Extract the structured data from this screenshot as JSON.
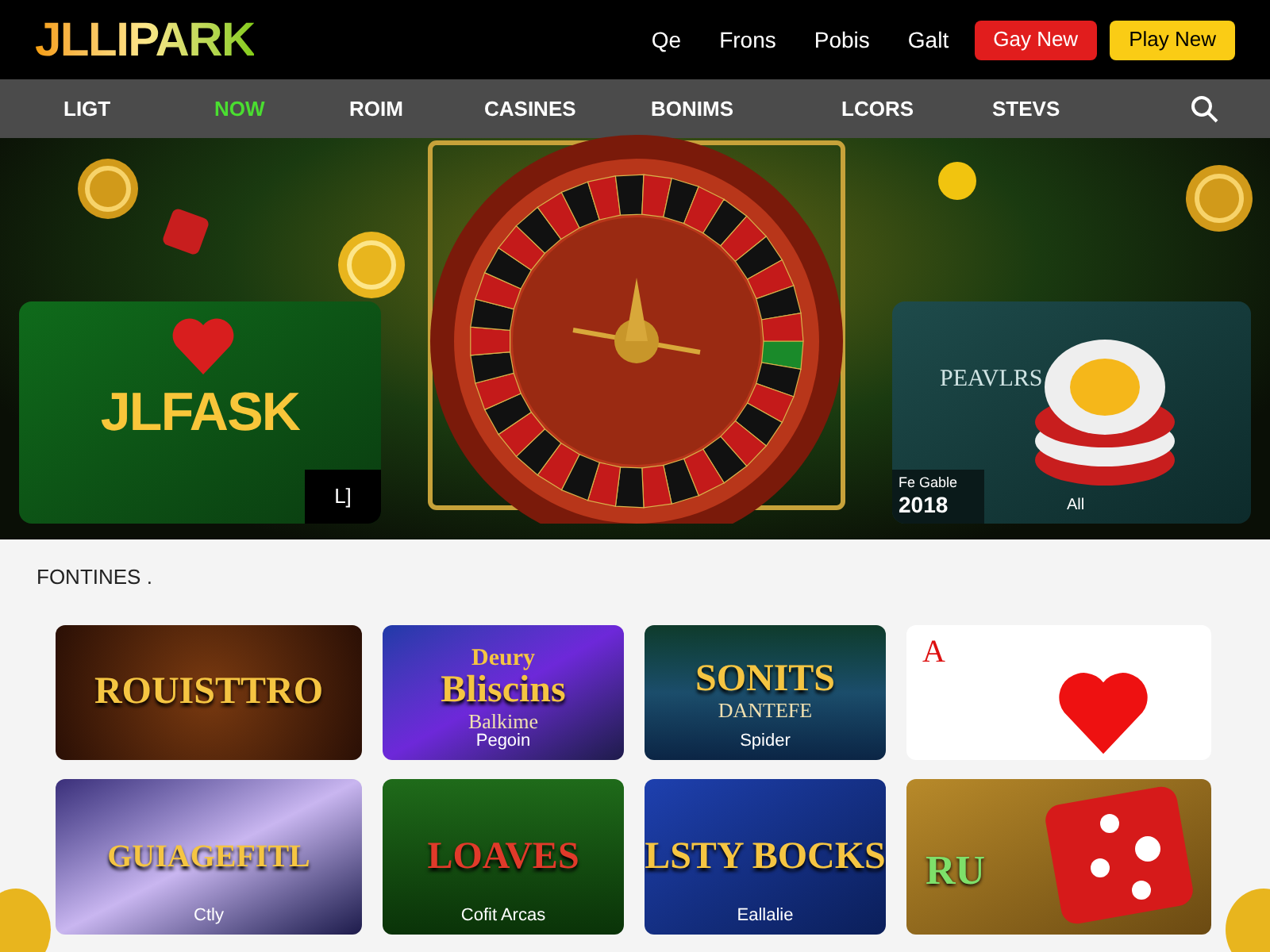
{
  "header": {
    "logo": "JLLIPARK",
    "links": [
      "Qe",
      "Frons",
      "Pobis",
      "Galt"
    ],
    "buttons": [
      {
        "label": "Gay New",
        "kind": "primary"
      },
      {
        "label": "Play New",
        "kind": "accent"
      }
    ]
  },
  "nav": {
    "items": [
      {
        "label": "LIGT",
        "selected": false
      },
      {
        "label": "NOW",
        "selected": true
      },
      {
        "label": "ROIM",
        "selected": false
      },
      {
        "label": "CASINES",
        "selected": false
      },
      {
        "label": "BONIMS",
        "selected": false
      },
      {
        "label": "LCORS",
        "selected": false
      },
      {
        "label": "STEVS",
        "selected": false
      }
    ]
  },
  "hero": {
    "left_card": {
      "title": "JLFASK",
      "badge": "L]"
    },
    "right_card": {
      "title": "PEAVLRS",
      "caption": "Fe Gable",
      "year": "2018",
      "label": "All"
    }
  },
  "section": {
    "heading": "FONTINES ."
  },
  "games": [
    {
      "kind": "roulette",
      "title": "ROUISTTRO"
    },
    {
      "kind": "slot",
      "overline": "Deury",
      "title": "Bliscins",
      "subtitle": "Balkime",
      "caption": "Pegoin"
    },
    {
      "kind": "planet",
      "title": "SONITS",
      "subtitle": "DANTEFE",
      "caption": "Spider"
    },
    {
      "kind": "cards",
      "title": "A"
    },
    {
      "kind": "space",
      "title": "GUIAGEFITL",
      "caption": "Ctly"
    },
    {
      "kind": "jungle",
      "title": "LOAVES",
      "caption": "Cofit Arcas"
    },
    {
      "kind": "wheel",
      "title": "LSTY BOCKS",
      "caption": "Eallalie"
    },
    {
      "kind": "dice",
      "title": "RU"
    }
  ]
}
